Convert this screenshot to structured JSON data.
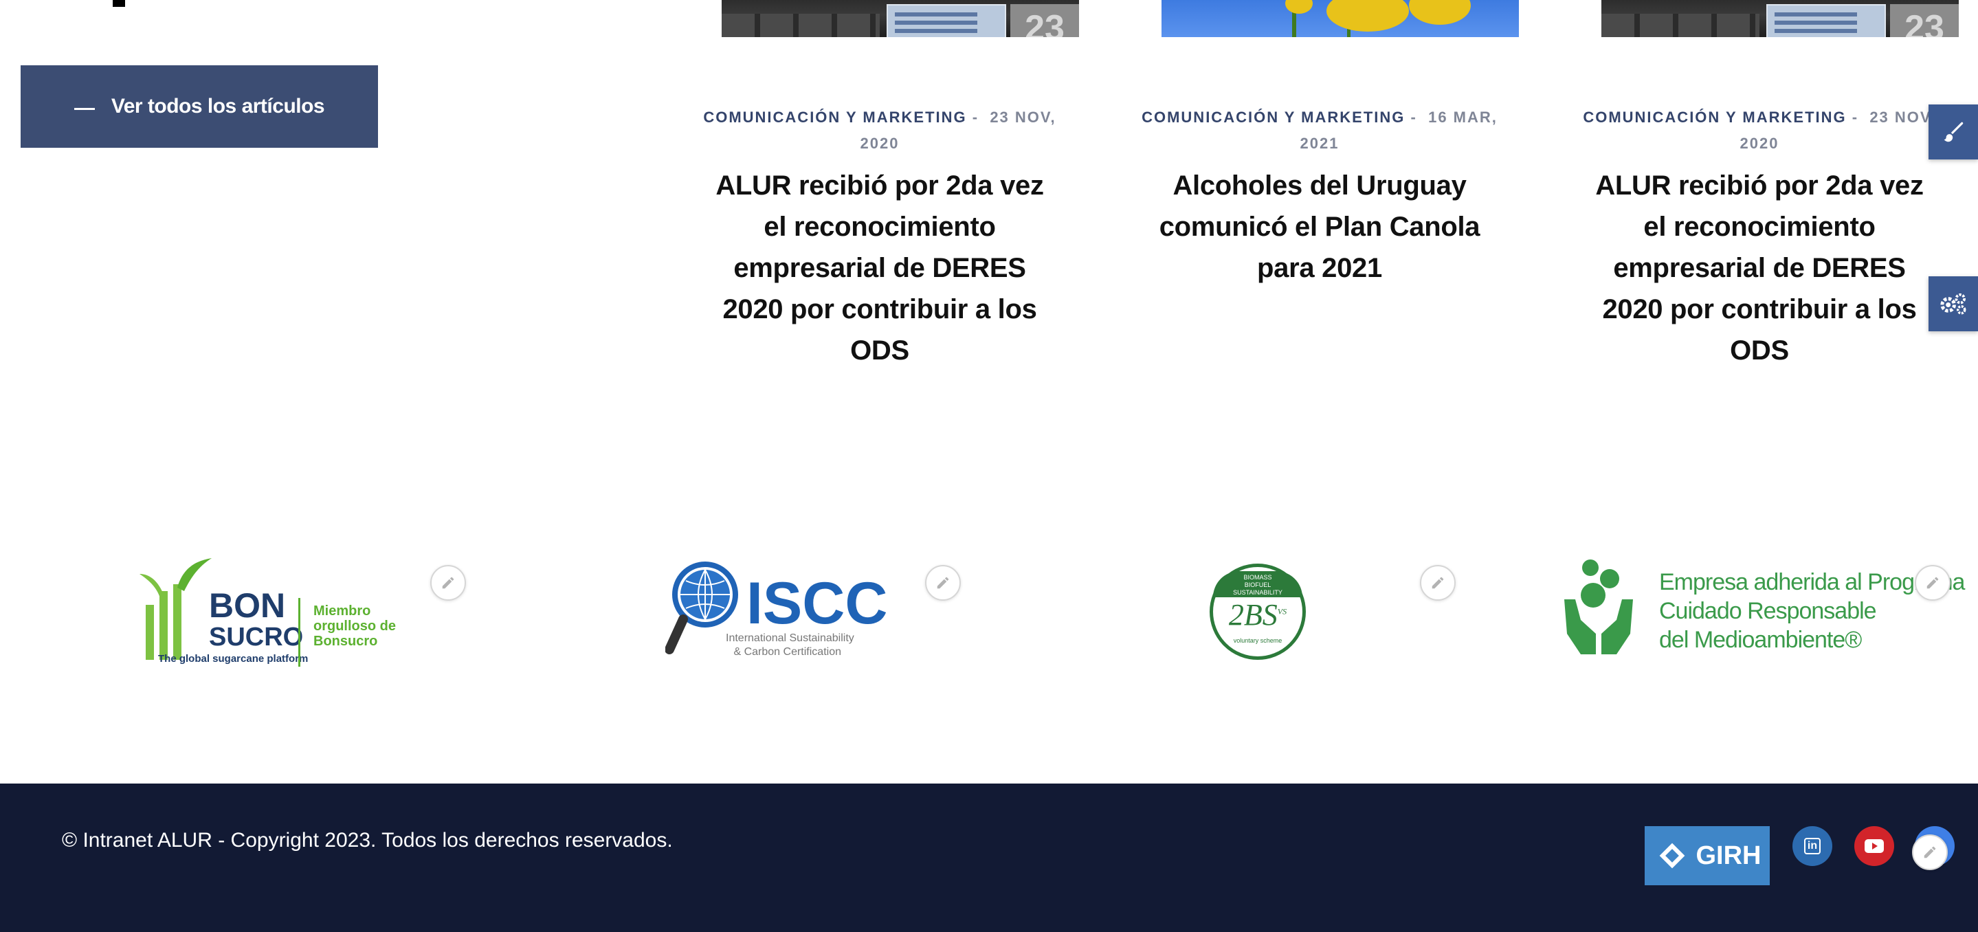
{
  "view_all": {
    "label": "Ver todos los artículos"
  },
  "articles": [
    {
      "category": "COMUNICACIÓN Y MARKETING",
      "separator": "-",
      "date_line1": "23 NOV,",
      "date_line2": "2020",
      "title": "ALUR recibió por 2da vez el reconocimiento empresarial de DERES 2020 por contribuir a los ODS",
      "image_icon": "conference-hall-image",
      "image_number": "23"
    },
    {
      "category": "COMUNICACIÓN Y MARKETING",
      "separator": "-",
      "date_line1": "16 MAR,",
      "date_line2": "2021",
      "title": "Alcoholes del Uruguay comunicó el Plan Canola para 2021",
      "image_icon": "canola-flower-image"
    },
    {
      "category": "COMUNICACIÓN Y MARKETING",
      "separator": "-",
      "date_line1": "23 NOV,",
      "date_line2": "2020",
      "title": "ALUR recibió por 2da vez el reconocimiento empresarial de DERES 2020 por contribuir a los ODS",
      "image_icon": "conference-hall-image",
      "image_number": "23"
    }
  ],
  "side_tools": {
    "top_icon": "brush-icon",
    "bottom_icon": "gears-icon"
  },
  "partners": {
    "bonsucro": {
      "name_line1": "BON",
      "name_line2": "SUCRO",
      "tagline": "The global sugarcane platform",
      "member_line1": "Miembro",
      "member_line2": "orgulloso de",
      "member_line3": "Bonsucro"
    },
    "iscc": {
      "name": "ISCC",
      "sub_line1": "International Sustainability",
      "sub_line2": "& Carbon Certification"
    },
    "twobs": {
      "top_line1": "BIOMASS",
      "top_line2": "BIOFUEL",
      "top_line3": "SUSTAINABILITY",
      "name": "2BS",
      "sup": "VS",
      "bottom": "voluntary scheme"
    },
    "cuidado": {
      "line1": "Empresa adherida al Programa",
      "line2": "Cuidado Responsable",
      "line3": "del Medioambiente®"
    },
    "edit_icon": "pencil-icon"
  },
  "footer": {
    "copyright": "© Intranet ALUR - Copyright 2023. Todos los derechos reservados.",
    "girh_label": "GIRH",
    "linkedin_label": "in",
    "youtube_icon": "youtube-icon",
    "edit_icon": "pencil-icon"
  },
  "colors": {
    "primary": "#3c4d73",
    "category": "#34446b",
    "footer_bg": "#121a34",
    "side_tab": "#3c5a92",
    "bonsucro_green": "#5cb130",
    "iscc_blue": "#1f63b6",
    "twobs_green": "#2c7a3a",
    "cuidado_green": "#3a9a4a",
    "girh_blue": "#3f86c8",
    "linkedin": "#2c6bb0",
    "youtube": "#d2242a"
  }
}
